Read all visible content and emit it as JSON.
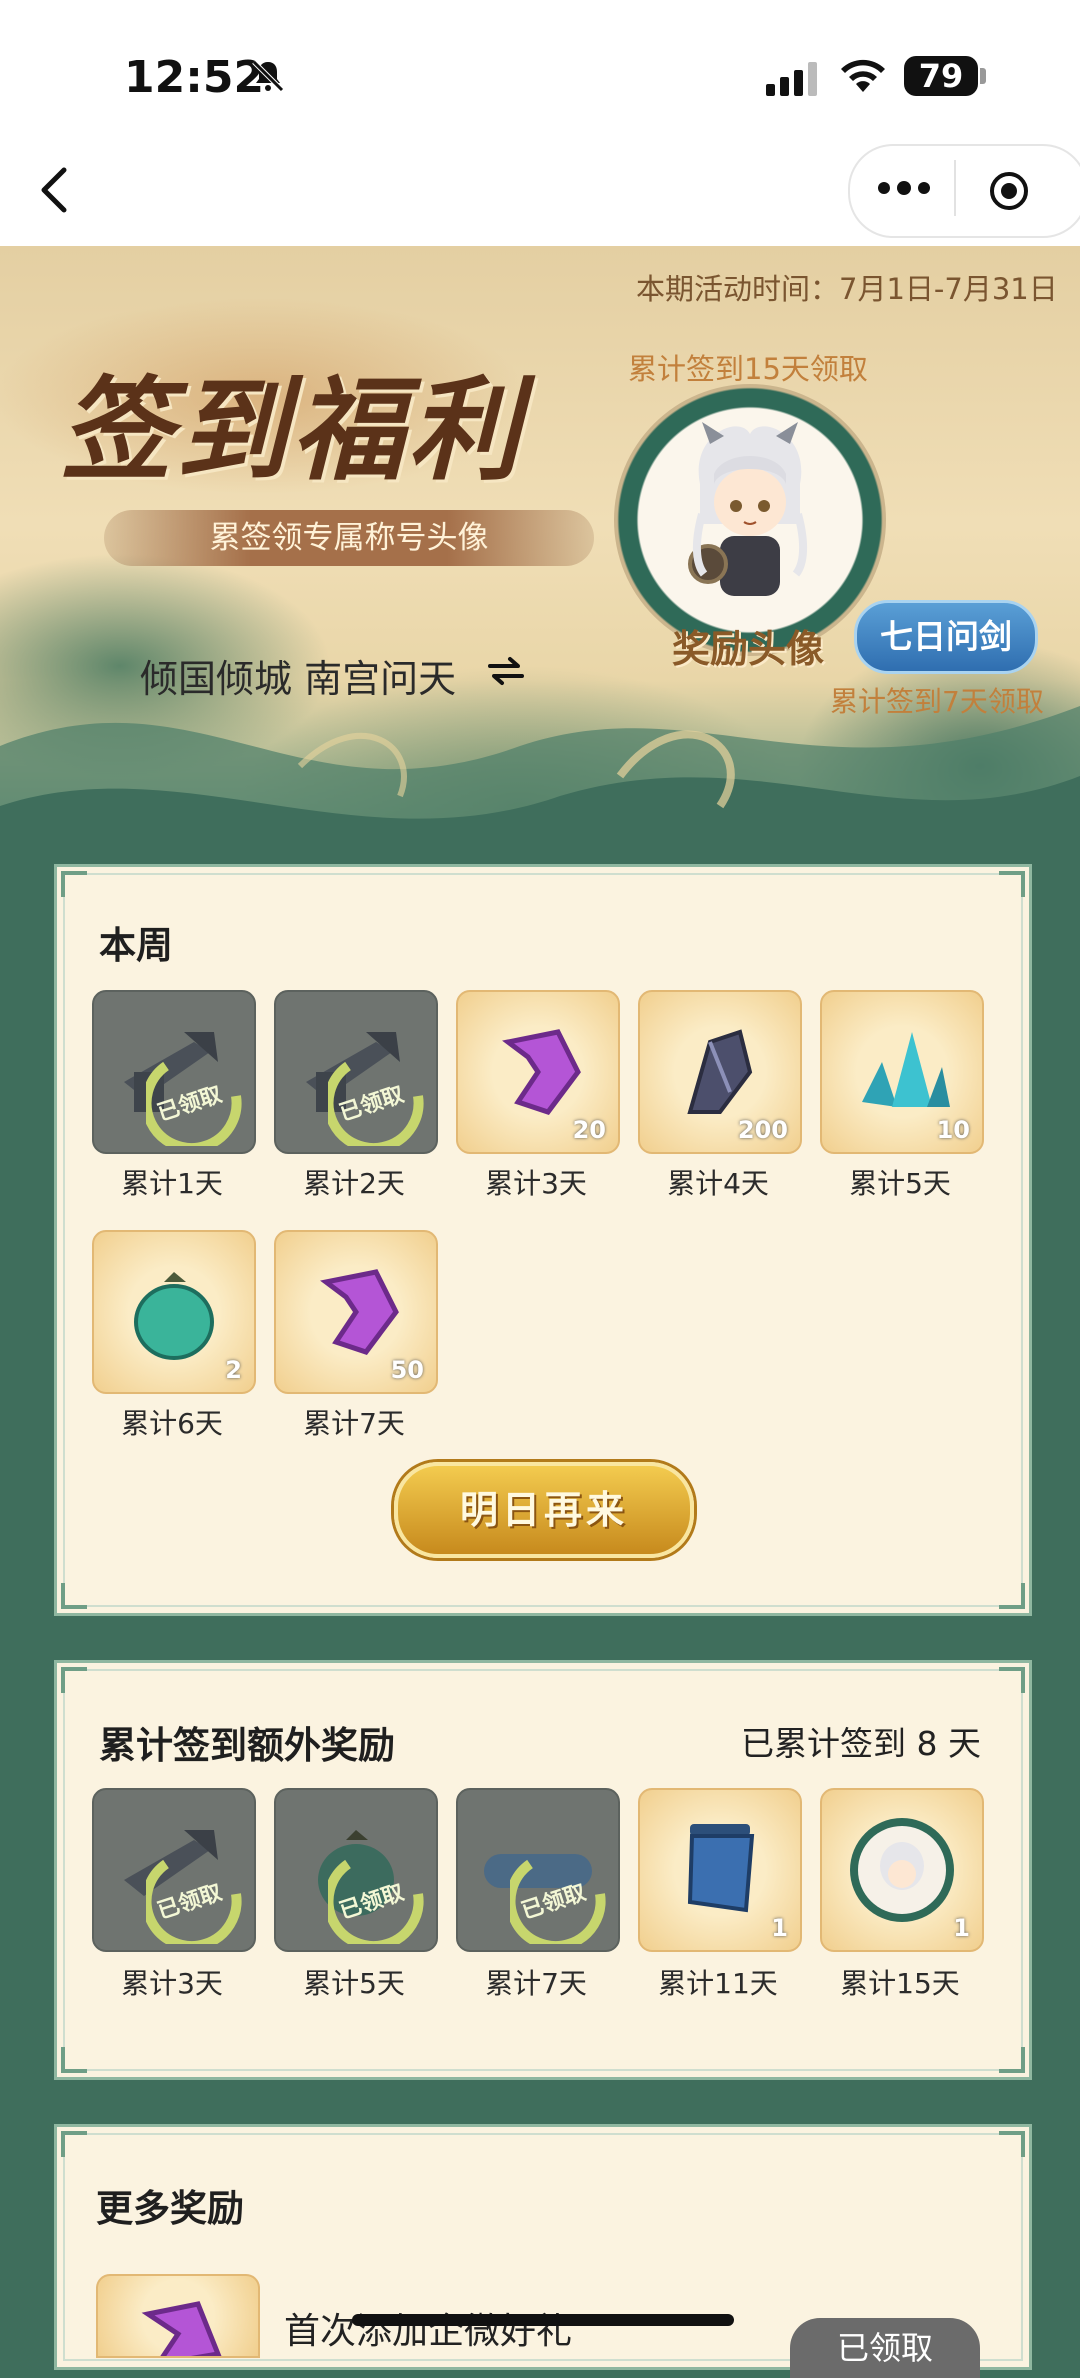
{
  "status_bar": {
    "time": "12:52",
    "battery": "79"
  },
  "banner": {
    "activity_time": "本期活动时间：7月1日-7月31日",
    "title": "签到福利",
    "subtitle": "累签领专属称号头像",
    "nickname": "倾国倾城 南宫问天",
    "note_15": "累计签到15天领取",
    "avatar_label": "奖励头像",
    "badge": "七日问剑",
    "note_7": "累计签到7天领取"
  },
  "week": {
    "title": "本周",
    "items": [
      {
        "label": "累计1天",
        "state": "claimed",
        "stamp": "已领取",
        "icon": "sword-icon"
      },
      {
        "label": "累计2天",
        "state": "claimed",
        "stamp": "已领取",
        "icon": "sword-icon"
      },
      {
        "label": "累计3天",
        "state": "unclaimed",
        "qty": "20",
        "icon": "purple-gem-icon"
      },
      {
        "label": "累计4天",
        "state": "unclaimed",
        "qty": "200",
        "icon": "dark-crystal-icon"
      },
      {
        "label": "累计5天",
        "state": "unclaimed",
        "qty": "10",
        "icon": "blue-crystal-icon"
      },
      {
        "label": "累计6天",
        "state": "unclaimed",
        "qty": "2",
        "icon": "jade-pouch-icon"
      },
      {
        "label": "累计7天",
        "state": "unclaimed",
        "qty": "50",
        "icon": "purple-gem-icon"
      }
    ],
    "button": "明日再来"
  },
  "cumulative": {
    "title": "累计签到额外奖励",
    "count": "已累计签到 8 天",
    "items": [
      {
        "label": "累计3天",
        "state": "claimed",
        "stamp": "已领取",
        "icon": "sword-icon"
      },
      {
        "label": "累计5天",
        "state": "claimed",
        "stamp": "已领取",
        "icon": "jade-pouch-icon"
      },
      {
        "label": "累计7天",
        "state": "claimed",
        "stamp": "已领取",
        "icon": "title-badge-icon"
      },
      {
        "label": "累计11天",
        "state": "unclaimed",
        "qty": "1",
        "icon": "flag-icon"
      },
      {
        "label": "累计15天",
        "state": "unclaimed",
        "qty": "1",
        "icon": "avatar-frame-icon"
      }
    ]
  },
  "more": {
    "title": "更多奖励",
    "first_text": "首次添加企微好礼",
    "first_button": "已领取"
  },
  "colors": {
    "accent_gold": "#c78a1d",
    "panel_bg": "#fbf3e0",
    "badge_blue": "#2f6eb0"
  }
}
